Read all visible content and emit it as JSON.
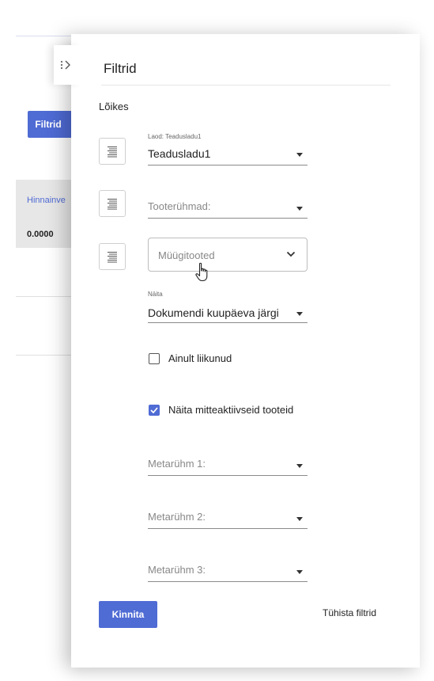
{
  "background": {
    "filter_button_label": "Filtrid",
    "column_header": "Hinnainve",
    "column_value": "0.0000"
  },
  "drawer": {
    "title": "Filtrid",
    "section_label": "Lõikes",
    "warehouse": {
      "floating_label": "Laod: Teadusladu1",
      "value": "Teadusladu1"
    },
    "product_groups": {
      "placeholder": "Tooterühmad:"
    },
    "sales_products": {
      "placeholder": "Müügitooted"
    },
    "show": {
      "floating_label": "Näita",
      "value": "Dokumendi kuupäeva järgi"
    },
    "checkboxes": [
      {
        "label": "Ainult liikunud",
        "checked": false
      },
      {
        "label": "Näita mitteaktiivseid tooteid",
        "checked": true
      }
    ],
    "meta_groups": [
      {
        "placeholder": "Metarühm 1:"
      },
      {
        "placeholder": "Metarühm 2:"
      },
      {
        "placeholder": "Metarühm 3:"
      }
    ],
    "confirm_label": "Kinnita",
    "reset_label": "Tühista filtrid"
  },
  "colors": {
    "accent": "#4f6bd4",
    "background_column": "#e7e7e7"
  },
  "icons": {
    "collapse": "chevron-right-icon",
    "align": "align-lines-icon",
    "dropdown": "caret-down-icon",
    "outlined_dropdown": "chevron-down-icon",
    "cursor": "hand-pointer-icon",
    "checkmark": "check-icon"
  }
}
